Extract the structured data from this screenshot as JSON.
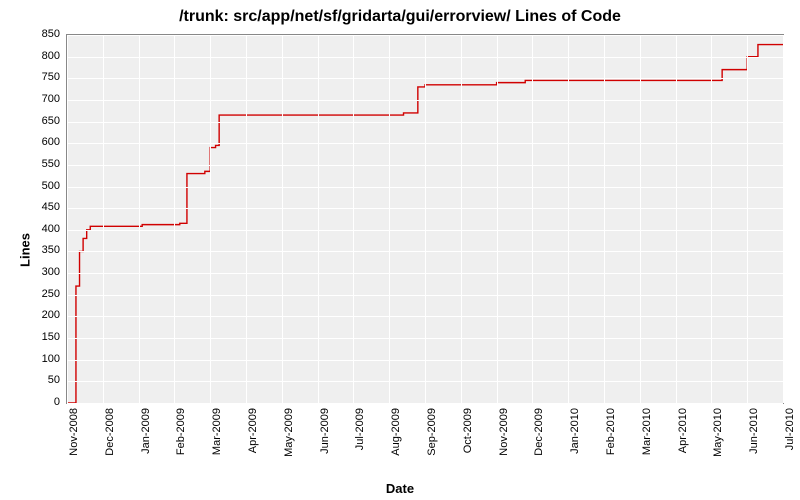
{
  "chart_data": {
    "type": "line",
    "title": "/trunk: src/app/net/sf/gridarta/gui/errorview/ Lines of Code",
    "xlabel": "Date",
    "ylabel": "Lines",
    "ylim": [
      0,
      850
    ],
    "yticks": [
      0,
      50,
      100,
      150,
      200,
      250,
      300,
      350,
      400,
      450,
      500,
      550,
      600,
      650,
      700,
      750,
      800,
      850
    ],
    "xticks": [
      "Nov-2008",
      "Dec-2008",
      "Jan-2009",
      "Feb-2009",
      "Mar-2009",
      "Apr-2009",
      "May-2009",
      "Jun-2009",
      "Jul-2009",
      "Aug-2009",
      "Sep-2009",
      "Oct-2009",
      "Nov-2009",
      "Dec-2009",
      "Jan-2010",
      "Feb-2010",
      "Mar-2010",
      "Apr-2010",
      "May-2010",
      "Jun-2010",
      "Jul-2010"
    ],
    "x": [
      0.0,
      0.25,
      0.35,
      0.45,
      0.55,
      0.65,
      1.25,
      2.1,
      3.15,
      3.25,
      3.35,
      3.7,
      3.85,
      4.0,
      4.15,
      4.25,
      9.2,
      9.4,
      9.8,
      10.0,
      12.0,
      12.1,
      12.8,
      13.0,
      18.0,
      18.3,
      18.7,
      19.0,
      19.3,
      19.7,
      20.0
    ],
    "values": [
      0,
      270,
      350,
      380,
      400,
      408,
      408,
      412,
      415,
      415,
      530,
      530,
      535,
      590,
      595,
      665,
      665,
      670,
      730,
      735,
      740,
      740,
      745,
      745,
      745,
      770,
      770,
      800,
      828,
      828,
      828
    ],
    "xlim": [
      0,
      20
    ]
  }
}
